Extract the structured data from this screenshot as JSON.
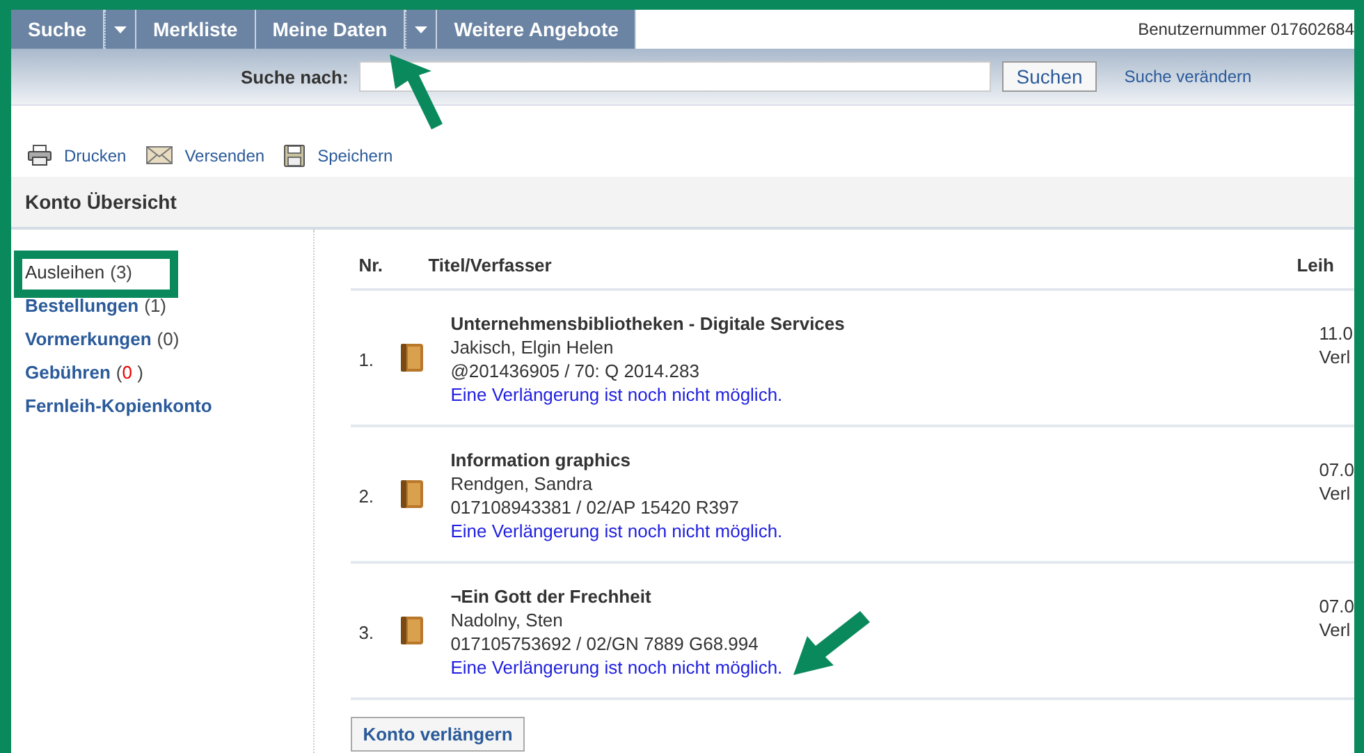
{
  "nav": {
    "tabs": [
      {
        "label": "Suche",
        "dropdown": true
      },
      {
        "label": "Merkliste",
        "dropdown": false
      },
      {
        "label": "Meine Daten",
        "dropdown": true
      },
      {
        "label": "Weitere Angebote",
        "dropdown": false
      }
    ],
    "user_number": "Benutzernummer 017602684"
  },
  "search": {
    "label": "Suche nach:",
    "button": "Suchen",
    "link": "Suche verändern"
  },
  "toolbar": [
    {
      "kind": "print",
      "label": "Drucken"
    },
    {
      "kind": "mail",
      "label": "Versenden"
    },
    {
      "kind": "save",
      "label": "Speichern"
    }
  ],
  "section_title": "Konto Übersicht",
  "sidebar": [
    {
      "label": "Ausleihen",
      "count": "(3)",
      "selected": true
    },
    {
      "label": "Bestellungen",
      "count": "(1)",
      "selected": false
    },
    {
      "label": "Vormerkungen",
      "count": "(0)",
      "selected": false
    },
    {
      "label": "Gebühren",
      "count_before": "(",
      "alert_count": "0",
      "count_after": " )",
      "selected": false
    },
    {
      "label": "Fernleih-Kopienkonto",
      "selected": false
    }
  ],
  "table": {
    "columns": [
      "Nr.",
      "Titel/Verfasser",
      "Leih"
    ],
    "rows": [
      {
        "nr": "1.",
        "title": "Unternehmensbibliotheken - Digitale Services",
        "author": "Jakisch, Elgin Helen",
        "signature": "@201436905 / 70: Q 2014.283",
        "note": "Eine Verlängerung ist noch nicht möglich.",
        "date": "11.0",
        "status": "Verl"
      },
      {
        "nr": "2.",
        "title": "Information graphics",
        "author": "Rendgen, Sandra",
        "signature": "017108943381 / 02/AP 15420 R397",
        "note": "Eine Verlängerung ist noch nicht möglich.",
        "date": "07.0",
        "status": "Verl"
      },
      {
        "nr": "3.",
        "title": "¬Ein Gott der Frechheit",
        "author": "Nadolny, Sten",
        "signature": "017105753692 / 02/GN 7889 G68.994",
        "note": "Eine Verlängerung ist noch nicht möglich.",
        "date": "07.0",
        "status": "Verl"
      }
    ]
  },
  "renew_button": "Konto verlängern"
}
